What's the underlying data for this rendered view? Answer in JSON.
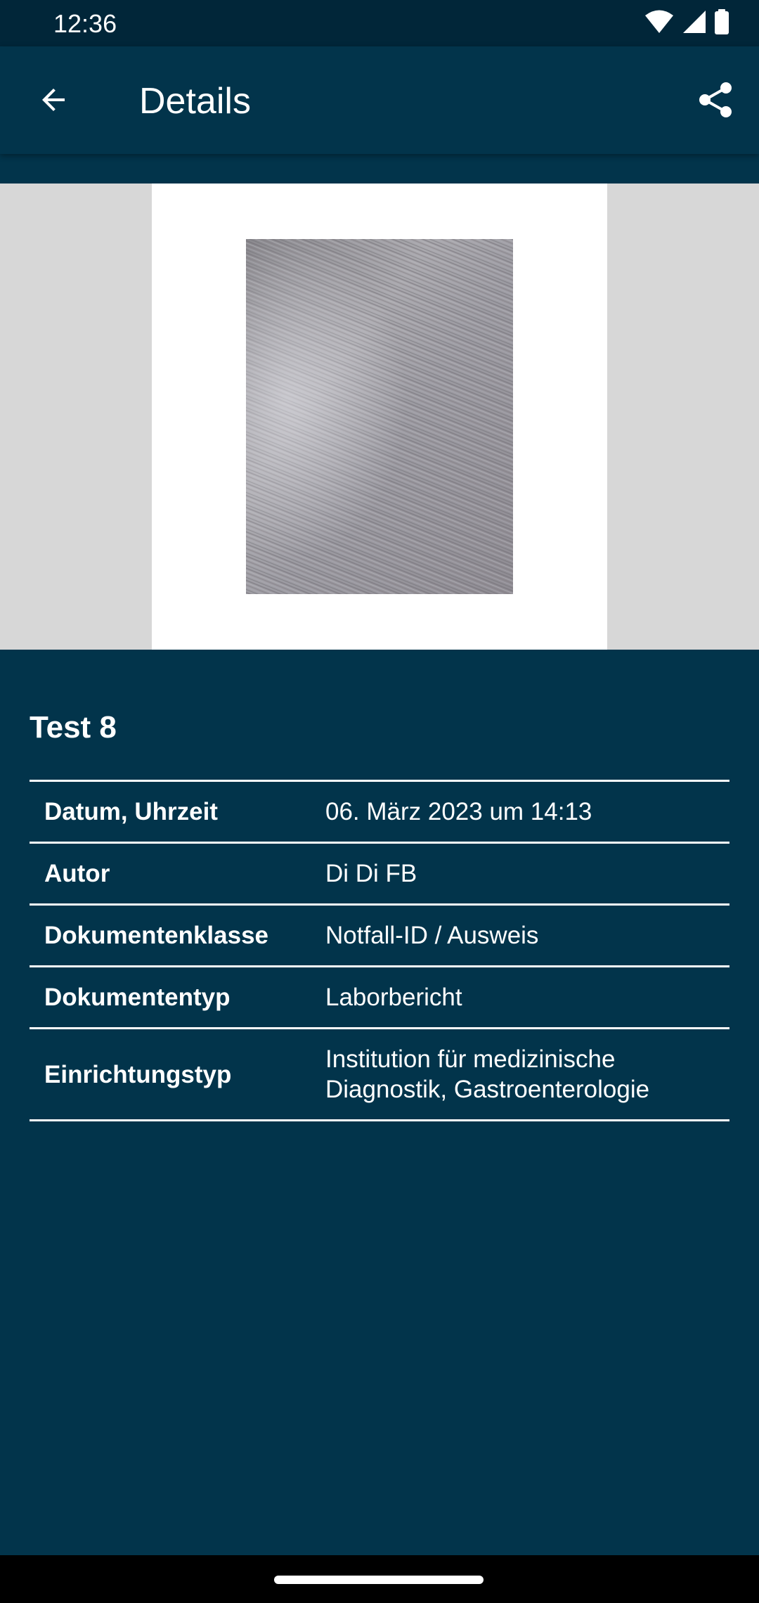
{
  "status_bar": {
    "time": "12:36",
    "icons": [
      "wifi-icon",
      "signal-icon",
      "battery-icon"
    ]
  },
  "app_bar": {
    "title": "Details",
    "back_icon": "arrow-back-icon",
    "share_icon": "share-icon"
  },
  "preview": {
    "page_background": "#ffffff",
    "area_background": "#d7d7d7"
  },
  "document": {
    "title": "Test 8",
    "rows": [
      {
        "label": "Datum, Uhrzeit",
        "value": "06. März 2023 um 14:13"
      },
      {
        "label": "Autor",
        "value": "Di Di FB"
      },
      {
        "label": "Dokumentenklasse",
        "value": "Notfall-ID / Ausweis"
      },
      {
        "label": "Dokumententyp",
        "value": "Laborbericht"
      },
      {
        "label": "Einrichtungstyp",
        "value": "Institution für medizinische Diagnostik, Gastroenterologie"
      }
    ]
  },
  "colors": {
    "primary": "#02344b",
    "status_bar": "#012639",
    "text": "#ffffff"
  }
}
